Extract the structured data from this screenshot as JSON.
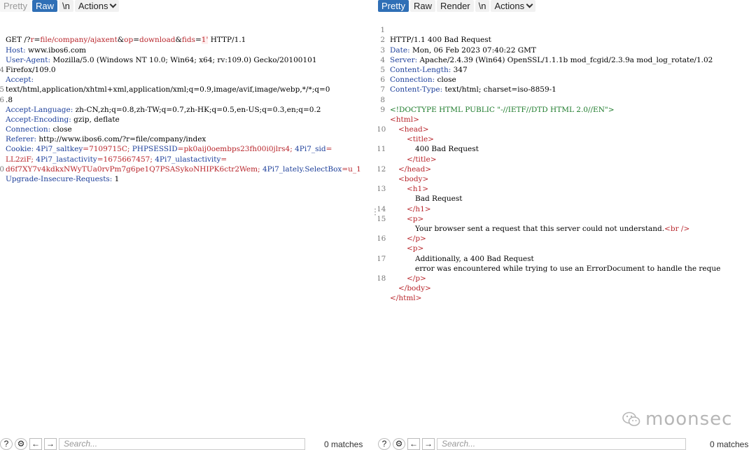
{
  "request": {
    "tabs": {
      "pretty": "Pretty",
      "raw": "Raw",
      "newline": "\\n",
      "actions": "Actions"
    },
    "line1": {
      "method": "GET /?",
      "p1": "r",
      "eq1": "=",
      "v1": "file/company/ajaxent",
      "amp1": "&",
      "p2": "op",
      "eq2": "=",
      "v2": "download",
      "amp2": "&",
      "p3": "fids",
      "eq3": "=",
      "v3": "1'",
      "proto": " HTTP/1.1"
    },
    "lines": {
      "host_k": "Host:",
      "host_v": " www.ibos6.com",
      "ua_k": "User-Agent:",
      "ua_v1": " Mozilla/5.0 (Windows NT 10.0; Win64; x64; rv:109.0) Gecko/20100101",
      "ua_v2": "Firefox/109.0",
      "accept_k": "Accept:",
      "accept_v1": "text/html,application/xhtml+xml,application/xml;q=0.9,image/avif,image/webp,*/*;q=0",
      "accept_v2": ".8",
      "lang_k": "Accept-Language:",
      "lang_v": " zh-CN,zh;q=0.8,zh-TW;q=0.7,zh-HK;q=0.5,en-US;q=0.3,en;q=0.2",
      "enc_k": "Accept-Encoding:",
      "enc_v": " gzip, deflate",
      "conn_k": "Connection:",
      "conn_v": " close",
      "ref_k": "Referer:",
      "ref_v": " http://www.ibos6.com/?r=file/company/index",
      "cookie_k": "Cookie:",
      "c1k": " 4Pi7_saltkey",
      "c1v": "=7109715C;",
      "c2k": " PHPSESSID",
      "c2v": "=pk0aij0oembps23fh00i0jlrs4;",
      "c3k": " 4Pi7_sid",
      "c3eq": "=",
      "c3v": "LL2ziF;",
      "c4k": " 4Pi7_lastactivity",
      "c4v": "=1675667457;",
      "c5k": " 4Pi7_ulastactivity",
      "c5eq": "=",
      "c5v": "d6f7XY7v4kdkxNWyTUa0rvPm7g6pe1Q7PSASykoNHIPK6ctr2Wem;",
      "c6k": " 4Pi7_lately.SelectBox",
      "c6v": "=u_1",
      "upg_k": "Upgrade-Insecure-Requests:",
      "upg_v": " 1"
    },
    "gutter": [
      "",
      "",
      "",
      "",
      "4",
      "",
      "5",
      "6",
      "",
      "",
      "",
      "",
      "",
      "",
      "0",
      "",
      ""
    ],
    "bottom": {
      "search_placeholder": "Search...",
      "matches": "0 matches"
    }
  },
  "response": {
    "tabs": {
      "pretty": "Pretty",
      "raw": "Raw",
      "render": "Render",
      "newline": "\\n",
      "actions": "Actions"
    },
    "gutter": [
      "1",
      "2",
      "3",
      "4",
      "5",
      "6",
      "7",
      "8",
      "9",
      "",
      "10",
      "",
      "11",
      "",
      "12",
      "",
      "13",
      "",
      "14",
      "15",
      "",
      "16",
      "",
      "17",
      "",
      "18"
    ],
    "lines": {
      "status": "HTTP/1.1 400 Bad Request",
      "date_k": "Date:",
      "date_v": " Mon, 06 Feb 2023 07:40:22 GMT",
      "server_k": "Server:",
      "server_v": " Apache/2.4.39 (Win64) OpenSSL/1.1.1b mod_fcgid/2.3.9a mod_log_rotate/1.02",
      "len_k": "Content-Length:",
      "len_v": " 347",
      "conn_k": "Connection:",
      "conn_v": " close",
      "ctype_k": "Content-Type:",
      "ctype_v": " text/html; charset=iso-8859-1",
      "doctype": "<!DOCTYPE HTML PUBLIC \"-//IETF//DTD HTML 2.0//EN\">",
      "html_open": "<html>",
      "head_open": "<head>",
      "title_open": "<title>",
      "title_text": "400 Bad Request",
      "title_close": "</title>",
      "head_close": "</head>",
      "body_open": "<body>",
      "h1_open": "<h1>",
      "h1_text": "Bad Request",
      "h1_close": "</h1>",
      "p_open": "<p>",
      "p1_text": "Your browser sent a request that this server could not understand.",
      "br": "<br />",
      "p_close": "</p>",
      "p2_open": "<p>",
      "p2_text1": "Additionally, a 400 Bad Request",
      "p2_text2": "error was encountered while trying to use an ErrorDocument to handle the reque",
      "p2_close": "</p>",
      "body_close": "</body>",
      "html_close": "</html>"
    },
    "bottom": {
      "search_placeholder": "Search...",
      "matches": "0 matches"
    }
  },
  "watermark": {
    "text": "moonsec"
  }
}
